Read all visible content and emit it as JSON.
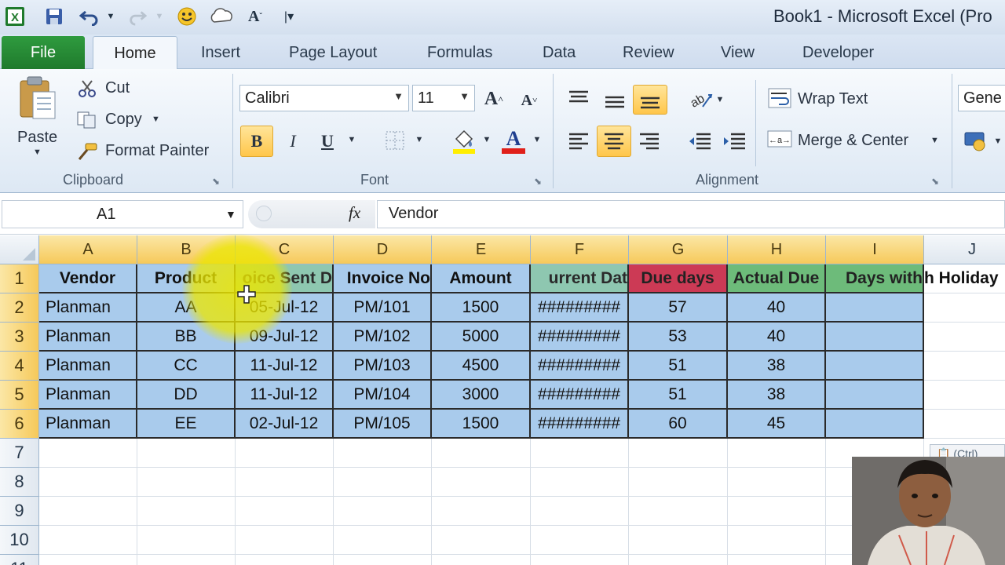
{
  "window": {
    "title": "Book1  -  Microsoft Excel (Pro"
  },
  "quick_access": [
    "excel-logo",
    "save-icon",
    "undo-icon",
    "redo-icon",
    "smiley-icon",
    "cloud-icon",
    "font-size-icon",
    "customize-icon"
  ],
  "tabs": {
    "file": "File",
    "home": "Home",
    "insert": "Insert",
    "page_layout": "Page Layout",
    "formulas": "Formulas",
    "data": "Data",
    "review": "Review",
    "view": "View",
    "developer": "Developer"
  },
  "ribbon": {
    "clipboard": {
      "paste": "Paste",
      "cut": "Cut",
      "copy": "Copy",
      "format_painter": "Format Painter",
      "label": "Clipboard"
    },
    "font": {
      "name": "Calibri",
      "size": "11",
      "bold": "B",
      "italic": "I",
      "underline": "U",
      "label": "Font",
      "font_color": "#e0201a",
      "fill_color": "#ffee00"
    },
    "alignment": {
      "wrap_text": "Wrap Text",
      "merge_center": "Merge & Center",
      "label": "Alignment"
    },
    "number": {
      "format": "Gene"
    }
  },
  "formula_bar": {
    "name_box": "A1",
    "fx": "fx",
    "content": "Vendor"
  },
  "columns": [
    "A",
    "B",
    "C",
    "D",
    "E",
    "F",
    "G",
    "H",
    "I",
    "J"
  ],
  "rows": [
    "1",
    "2",
    "3",
    "4",
    "5",
    "6",
    "7",
    "8",
    "9",
    "10",
    "11"
  ],
  "header_row": {
    "a": "Vendor",
    "b": "Product",
    "c": "oice Sent D",
    "d": "Invoice No",
    "e": "Amount",
    "f": "urrent Dat",
    "g": "Due days",
    "h": "Actual Due",
    "i": "Days with",
    "j": "h Holiday"
  },
  "data_rows": [
    {
      "vendor": "Planman",
      "product": "AA",
      "sent": "05-Jul-12",
      "invoice": "PM/101",
      "amount": "1500",
      "current": "#########",
      "due": "57",
      "actual": "40"
    },
    {
      "vendor": "Planman",
      "product": "BB",
      "sent": "09-Jul-12",
      "invoice": "PM/102",
      "amount": "5000",
      "current": "#########",
      "due": "53",
      "actual": "40"
    },
    {
      "vendor": "Planman",
      "product": "CC",
      "sent": "11-Jul-12",
      "invoice": "PM/103",
      "amount": "4500",
      "current": "#########",
      "due": "51",
      "actual": "38"
    },
    {
      "vendor": "Planman",
      "product": "DD",
      "sent": "11-Jul-12",
      "invoice": "PM/104",
      "amount": "3000",
      "current": "#########",
      "due": "51",
      "actual": "38"
    },
    {
      "vendor": "Planman",
      "product": "EE",
      "sent": "02-Jul-12",
      "invoice": "PM/105",
      "amount": "1500",
      "current": "#########",
      "due": "60",
      "actual": "45"
    }
  ],
  "paste_options": "(Ctrl)",
  "colors": {
    "selection_fill": "#a9cbec",
    "due_days_fill": "#cc3a55",
    "actual_due_fill": "#6dbb7a",
    "header_highlight": "#f6c95a",
    "file_tab": "#1f7a2c"
  }
}
